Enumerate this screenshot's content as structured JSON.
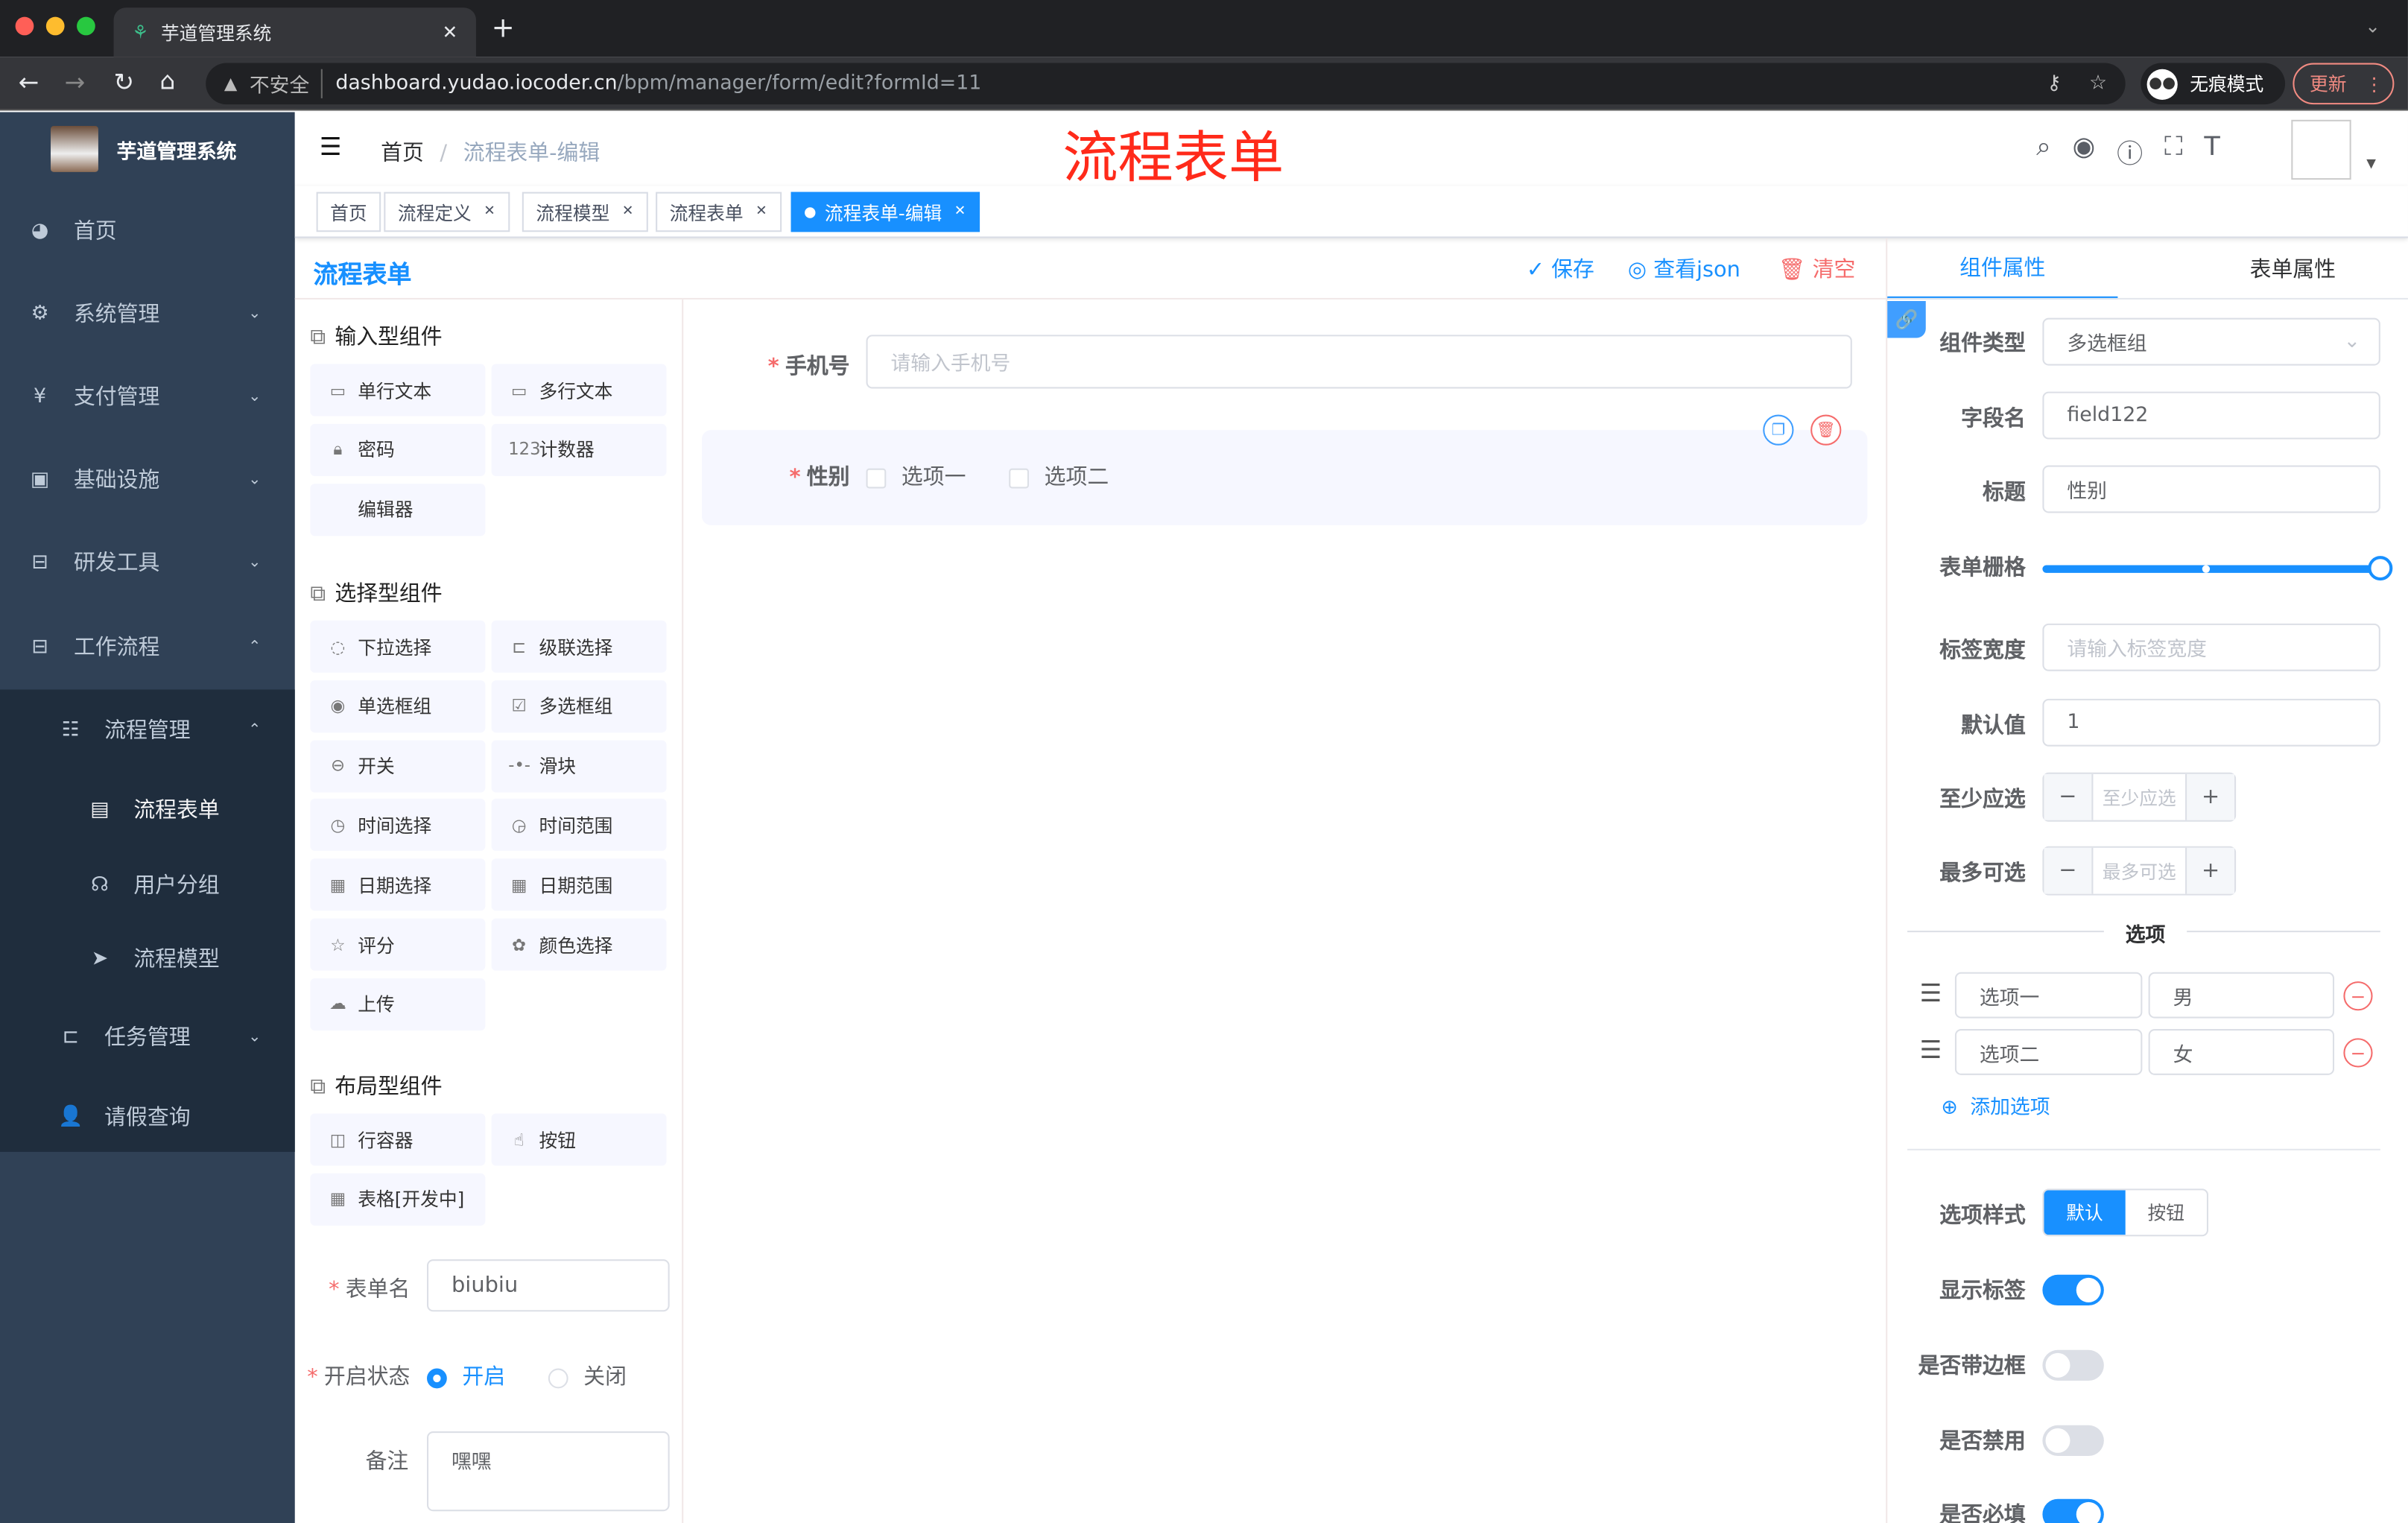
{
  "browser": {
    "tab_title": "芋道管理系统",
    "insecure": "不安全",
    "url_host": "dashboard.yudao.iocoder.cn",
    "url_path": "/bpm/manager/form/edit?formId=11",
    "incognito": "无痕模式",
    "update": "更新"
  },
  "sidebar": {
    "app_name": "芋道管理系统",
    "items": [
      {
        "label": "首页",
        "icon": "dashboard-icon"
      },
      {
        "label": "系统管理",
        "icon": "gear-icon"
      },
      {
        "label": "支付管理",
        "icon": "yen-icon"
      },
      {
        "label": "基础设施",
        "icon": "monitor-icon"
      },
      {
        "label": "研发工具",
        "icon": "toolbox-icon"
      },
      {
        "label": "工作流程",
        "icon": "toolbox-icon"
      },
      {
        "label": "流程管理",
        "icon": "list-icon"
      },
      {
        "label": "流程表单",
        "icon": "form-icon"
      },
      {
        "label": "用户分组",
        "icon": "group-icon"
      },
      {
        "label": "流程模型",
        "icon": "send-icon"
      },
      {
        "label": "任务管理",
        "icon": "tree-icon"
      },
      {
        "label": "请假查询",
        "icon": "user-icon"
      }
    ]
  },
  "navbar": {
    "breadcrumb": [
      "首页",
      "流程表单-编辑"
    ],
    "separator": "/",
    "overlay_title": "流程表单"
  },
  "tags": [
    {
      "label": "首页"
    },
    {
      "label": "流程定义"
    },
    {
      "label": "流程模型"
    },
    {
      "label": "流程表单"
    },
    {
      "label": "流程表单-编辑",
      "active": true
    }
  ],
  "editor": {
    "title": "流程表单",
    "save": "保存",
    "view_json": "查看json",
    "clear": "清空"
  },
  "palette": {
    "sections": [
      {
        "title": "输入型组件",
        "items": [
          "单行文本",
          "多行文本",
          "密码",
          "计数器",
          "编辑器"
        ]
      },
      {
        "title": "选择型组件",
        "items": [
          "下拉选择",
          "级联选择",
          "单选框组",
          "多选框组",
          "开关",
          "滑块",
          "时间选择",
          "时间范围",
          "日期选择",
          "日期范围",
          "评分",
          "颜色选择",
          "上传"
        ]
      },
      {
        "title": "布局型组件",
        "items": [
          "行容器",
          "按钮",
          "表格[开发中]"
        ]
      }
    ]
  },
  "form_meta": {
    "name_label": "表单名",
    "name_value": "biubiu",
    "status_label": "开启状态",
    "status_on": "开启",
    "status_off": "关闭",
    "status_value": "开启",
    "remark_label": "备注",
    "remark_value": "嘿嘿"
  },
  "canvas": {
    "phone_label": "手机号",
    "phone_placeholder": "请输入手机号",
    "gender_label": "性别",
    "options": [
      "选项一",
      "选项二"
    ]
  },
  "props": {
    "tab_component": "组件属性",
    "tab_form": "表单属性",
    "type_label": "组件类型",
    "type_value": "多选框组",
    "field_label": "字段名",
    "field_value": "field122",
    "title_label": "标题",
    "title_value": "性别",
    "grid_label": "表单栅格",
    "grid_value": 24,
    "label_width_label": "标签宽度",
    "label_width_placeholder": "请输入标签宽度",
    "default_label": "默认值",
    "default_value": "1",
    "min_label": "至少应选",
    "min_placeholder": "至少应选",
    "max_label": "最多可选",
    "max_placeholder": "最多可选",
    "options_divider": "选项",
    "options": [
      {
        "label": "选项一",
        "value": "男"
      },
      {
        "label": "选项二",
        "value": "女"
      }
    ],
    "add_option": "添加选项",
    "style_label": "选项样式",
    "style_default": "默认",
    "style_button": "按钮",
    "show_label": "显示标签",
    "show_label_on": true,
    "border_label": "是否带边框",
    "border_on": false,
    "disabled_label": "是否禁用",
    "disabled_on": false,
    "required_label": "是否必填",
    "required_on": true
  },
  "colors": {
    "primary": "#1890ff",
    "sidebar": "#304156",
    "danger": "#f56c6c",
    "overlay_title": "#ff2a1a"
  }
}
